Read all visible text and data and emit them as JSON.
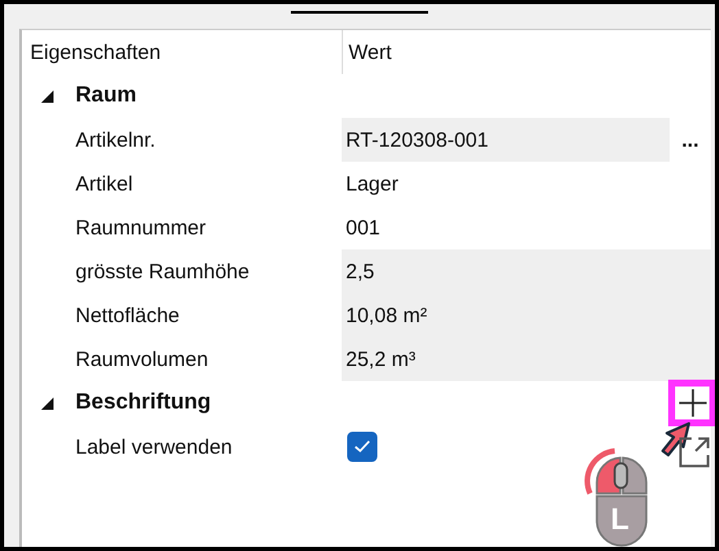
{
  "columns": [
    "Eigenschaften",
    "Wert"
  ],
  "groups": [
    {
      "title": "Raum",
      "expanded": true,
      "rows": [
        {
          "kind": "text",
          "label": "Artikelnr.",
          "value": "RT-120308-001",
          "shaded": true,
          "action": "..."
        },
        {
          "kind": "text",
          "label": "Artikel",
          "value": "Lager",
          "shaded": false
        },
        {
          "kind": "text",
          "label": "Raumnummer",
          "value": "001",
          "shaded": false
        },
        {
          "kind": "text",
          "label": "grösste Raumhöhe",
          "value": "2,5",
          "shaded": true
        },
        {
          "kind": "text",
          "label": "Nettofläche",
          "value": "10,08 m²",
          "shaded": true
        },
        {
          "kind": "text",
          "label": "Raumvolumen",
          "value": "25,2 m³",
          "shaded": true
        }
      ]
    },
    {
      "title": "Beschriftung",
      "expanded": true,
      "rows": [
        {
          "kind": "checkbox",
          "label": "Label verwenden",
          "checked": true
        }
      ]
    }
  ],
  "mouse_hint": {
    "button": "L"
  }
}
